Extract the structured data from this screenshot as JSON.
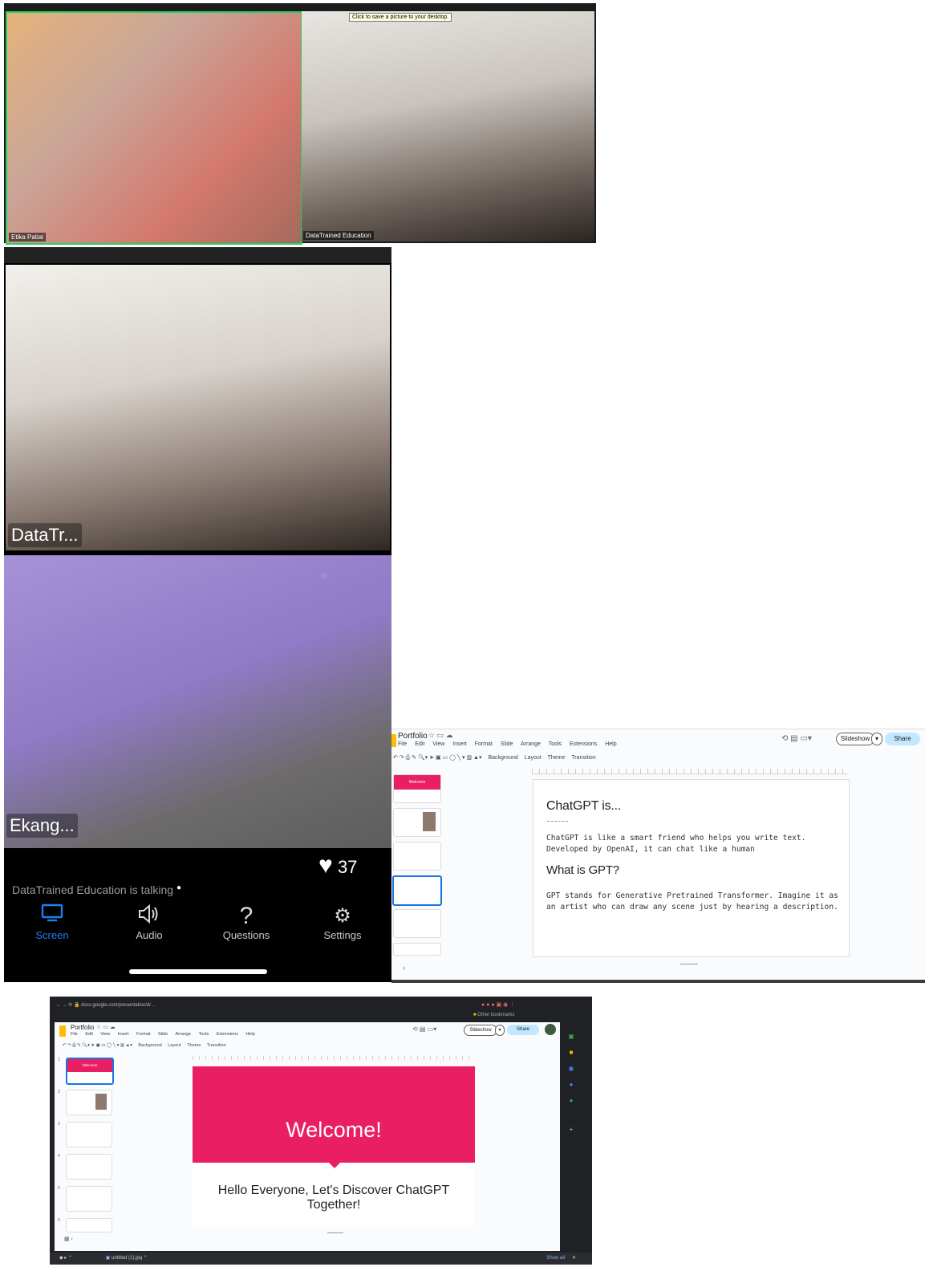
{
  "zoom_call": {
    "tooltip": "Click to save a picture to your desktop.",
    "tiles": [
      {
        "name": "Etika Patial"
      },
      {
        "name": "DataTrained Education"
      }
    ]
  },
  "mobile_call": {
    "speaker_name": "DataTr...",
    "self_name": "Ekang...",
    "likes": "37",
    "status": "DataTrained Education is talking",
    "tabs": [
      {
        "label": "Screen",
        "icon": "monitor-icon",
        "active": true
      },
      {
        "label": "Audio",
        "icon": "speaker-icon",
        "active": false
      },
      {
        "label": "Questions",
        "icon": "question-icon",
        "active": false
      },
      {
        "label": "Settings",
        "icon": "gear-icon",
        "active": false
      }
    ],
    "active_color": "#1f7ef0"
  },
  "slides_small": {
    "title": "Portfolio",
    "menu": [
      "File",
      "Edit",
      "View",
      "Insert",
      "Format",
      "Slide",
      "Arrange",
      "Tools",
      "Extensions",
      "Help"
    ],
    "toolbar": [
      "Background",
      "Layout",
      "Theme",
      "Transition"
    ],
    "slideshow_label": "Slideshow",
    "share_label": "Share",
    "thumb1_title": "Welcome",
    "slide": {
      "heading": "ChatGPT is...",
      "para1": "ChatGPT is like a smart friend who helps you write text. Developed by OpenAI, it can chat like a human",
      "subheading": "What is GPT?",
      "para2": "GPT stands for Generative Pretrained Transformer. Imagine it as an artist who can draw any scene just by hearing a description."
    }
  },
  "slides_large": {
    "title": "Portfolio",
    "menu": [
      "File",
      "Edit",
      "View",
      "Insert",
      "Format",
      "Slide",
      "Arrange",
      "Tools",
      "Extensions",
      "Help"
    ],
    "toolbar": [
      "Background",
      "Layout",
      "Theme",
      "Transition"
    ],
    "slideshow_label": "Slideshow",
    "share_label": "Share",
    "bookmark_right": "Other bookmarks",
    "thumb_numbers": [
      "1",
      "2",
      "3",
      "4",
      "5",
      "6"
    ],
    "thumb1_title": "Welcome",
    "slide": {
      "title": "Welcome!",
      "subtitle": "Hello Everyone, Let's Discover ChatGPT Together!"
    },
    "download_item": "untitled (1).jpg",
    "show_all": "Show all",
    "accent_color": "#e91e63"
  }
}
